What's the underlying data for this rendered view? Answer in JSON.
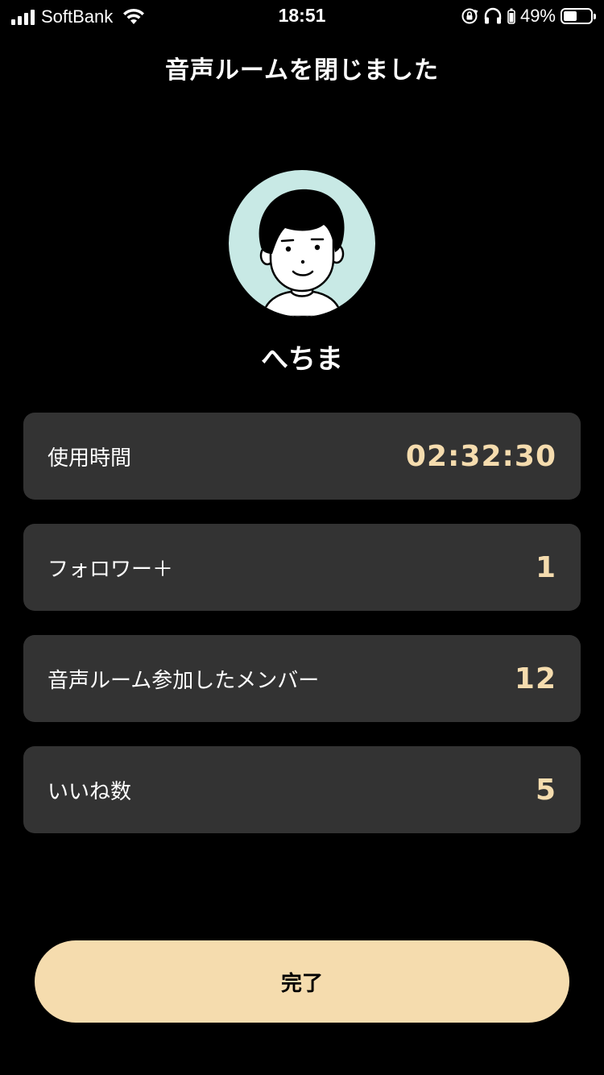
{
  "status_bar": {
    "carrier": "SoftBank",
    "time": "18:51",
    "battery_percent": "49%",
    "battery_level": 0.49,
    "icons": [
      "signal-icon",
      "wifi-icon",
      "orientation-lock-icon",
      "headphones-icon",
      "battery-icon"
    ]
  },
  "header": {
    "title": "音声ルームを閉じました"
  },
  "profile": {
    "name": "へちま",
    "avatar_bg": "#c8e9e5"
  },
  "stats": [
    {
      "label": "使用時間",
      "value": "02:32:30"
    },
    {
      "label": "フォロワー＋",
      "value": "1"
    },
    {
      "label": "音声ルーム参加したメンバー",
      "value": "12"
    },
    {
      "label": "いいね数",
      "value": "5"
    }
  ],
  "actions": {
    "done_label": "完了"
  },
  "colors": {
    "background": "#000000",
    "card": "#333333",
    "accent": "#f5dcae"
  }
}
